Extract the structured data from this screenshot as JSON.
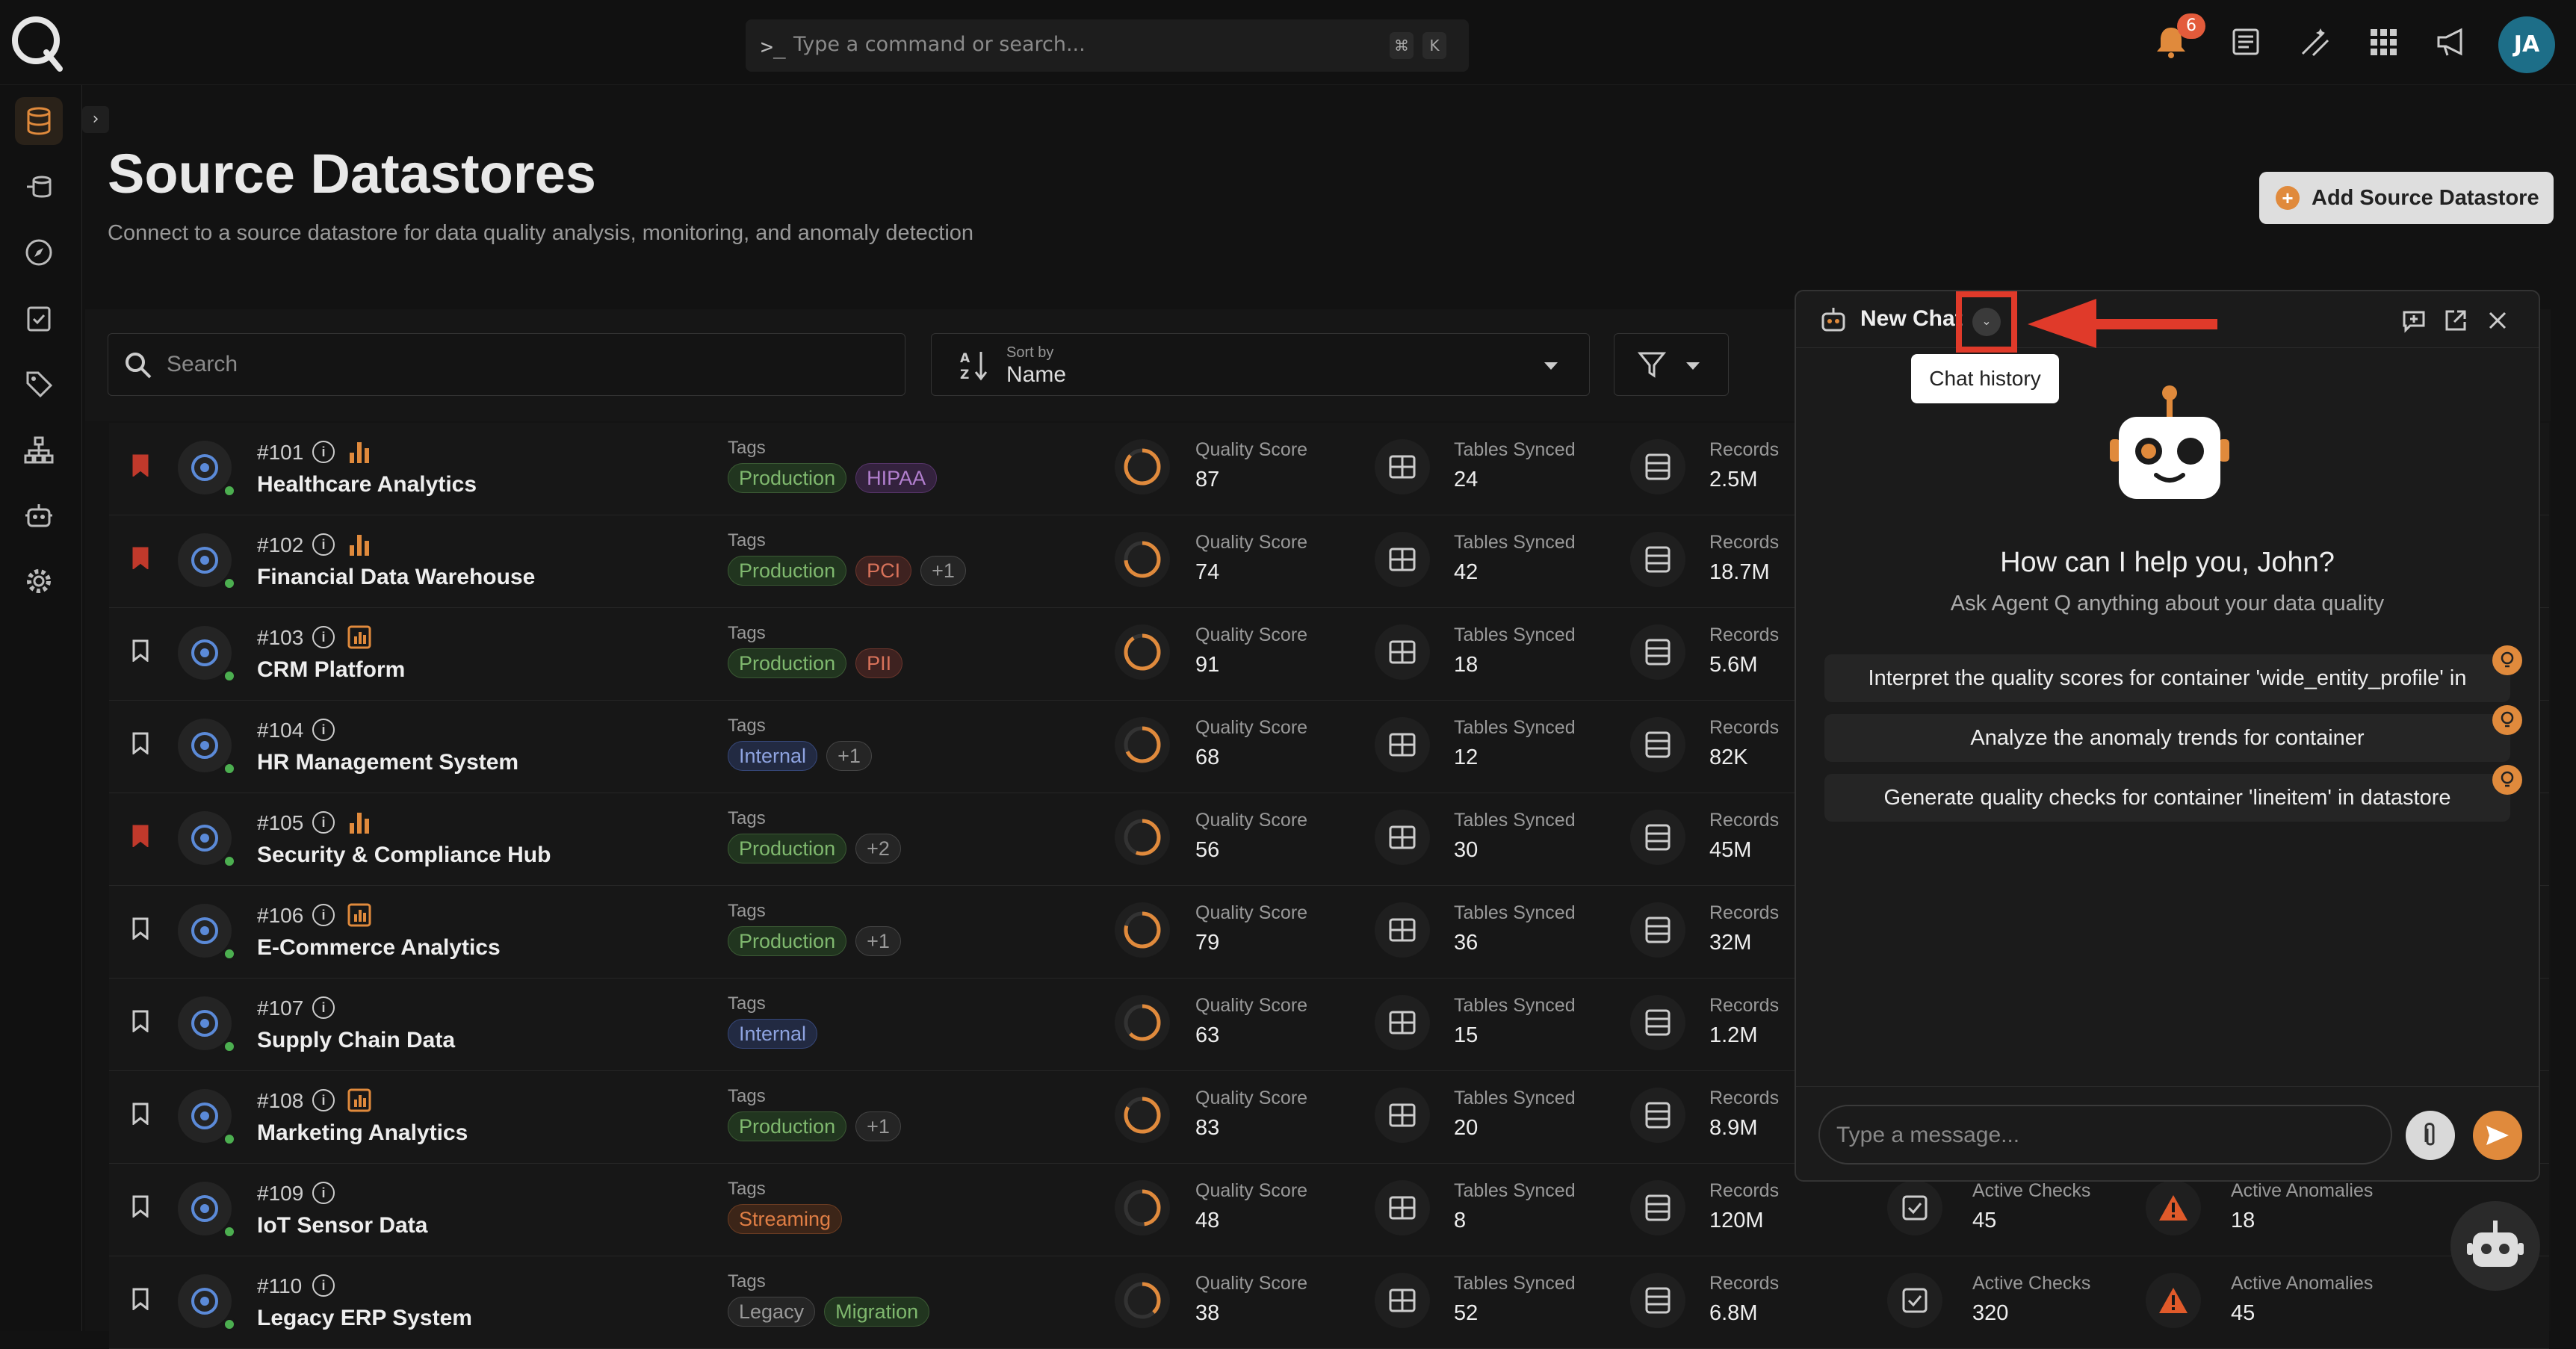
{
  "command": {
    "placeholder": "Type a command or search...",
    "key1": "⌘",
    "key2": "K"
  },
  "notifications": {
    "count": "6"
  },
  "user": {
    "initials": "JA"
  },
  "page": {
    "title": "Source Datastores",
    "subtitle": "Connect to a source datastore for data quality analysis, monitoring, and anomaly detection",
    "add_button": "Add Source Datastore"
  },
  "toolbar": {
    "search_placeholder": "Search",
    "sort_label": "Sort by",
    "sort_value": "Name"
  },
  "labels": {
    "tags": "Tags",
    "quality": "Quality Score",
    "tables": "Tables Synced",
    "records": "Records",
    "checks": "Active Checks",
    "anomalies": "Active Anomalies"
  },
  "rows": [
    {
      "num": "#101",
      "name": "Healthcare Analytics",
      "bookmarked": true,
      "stat": "bars",
      "tags": [
        [
          "Production",
          "green"
        ],
        [
          "HIPAA",
          "purple"
        ]
      ],
      "quality": "87",
      "tables": "24",
      "records": "2.5M",
      "checks": "",
      "anomalies": ""
    },
    {
      "num": "#102",
      "name": "Financial Data Warehouse",
      "bookmarked": true,
      "stat": "bars",
      "tags": [
        [
          "Production",
          "green"
        ],
        [
          "PCI",
          "red"
        ],
        [
          "+1",
          "gray"
        ]
      ],
      "quality": "74",
      "tables": "42",
      "records": "18.7M",
      "checks": "",
      "anomalies": ""
    },
    {
      "num": "#103",
      "name": "CRM Platform",
      "bookmarked": false,
      "stat": "box",
      "tags": [
        [
          "Production",
          "green"
        ],
        [
          "PII",
          "red"
        ]
      ],
      "quality": "91",
      "tables": "18",
      "records": "5.6M",
      "checks": "",
      "anomalies": ""
    },
    {
      "num": "#104",
      "name": "HR Management System",
      "bookmarked": false,
      "stat": "",
      "tags": [
        [
          "Internal",
          "blue"
        ],
        [
          "+1",
          "gray"
        ]
      ],
      "quality": "68",
      "tables": "12",
      "records": "82K",
      "checks": "",
      "anomalies": ""
    },
    {
      "num": "#105",
      "name": "Security & Compliance Hub",
      "bookmarked": true,
      "stat": "bars",
      "tags": [
        [
          "Production",
          "green"
        ],
        [
          "+2",
          "gray"
        ]
      ],
      "quality": "56",
      "tables": "30",
      "records": "45M",
      "checks": "",
      "anomalies": ""
    },
    {
      "num": "#106",
      "name": "E-Commerce Analytics",
      "bookmarked": false,
      "stat": "box",
      "tags": [
        [
          "Production",
          "green"
        ],
        [
          "+1",
          "gray"
        ]
      ],
      "quality": "79",
      "tables": "36",
      "records": "32M",
      "checks": "",
      "anomalies": ""
    },
    {
      "num": "#107",
      "name": "Supply Chain Data",
      "bookmarked": false,
      "stat": "",
      "tags": [
        [
          "Internal",
          "blue"
        ]
      ],
      "quality": "63",
      "tables": "15",
      "records": "1.2M",
      "checks": "",
      "anomalies": ""
    },
    {
      "num": "#108",
      "name": "Marketing Analytics",
      "bookmarked": false,
      "stat": "box",
      "tags": [
        [
          "Production",
          "green"
        ],
        [
          "+1",
          "gray"
        ]
      ],
      "quality": "83",
      "tables": "20",
      "records": "8.9M",
      "checks": "",
      "anomalies": ""
    },
    {
      "num": "#109",
      "name": "IoT Sensor Data",
      "bookmarked": false,
      "stat": "",
      "tags": [
        [
          "Streaming",
          "orange"
        ]
      ],
      "quality": "48",
      "tables": "8",
      "records": "120M",
      "checks": "45",
      "anomalies": "18"
    },
    {
      "num": "#110",
      "name": "Legacy ERP System",
      "bookmarked": false,
      "stat": "",
      "tags": [
        [
          "Legacy",
          "gray"
        ],
        [
          "Migration",
          "green"
        ]
      ],
      "quality": "38",
      "tables": "52",
      "records": "6.8M",
      "checks": "320",
      "anomalies": "45"
    }
  ],
  "chat": {
    "title": "New Chat",
    "tooltip": "Chat history",
    "greeting": "How can I help you, John?",
    "subgreeting": "Ask Agent Q anything about your data quality",
    "suggestions": [
      "Interpret the quality scores for container 'wide_entity_profile' in",
      "Analyze the anomaly trends for container",
      "Generate quality checks for container 'lineitem' in datastore"
    ],
    "message_placeholder": "Type a message..."
  },
  "colors": {
    "accent": "#e08a3c",
    "highlight": "#e03a2a",
    "online": "#4caf50"
  }
}
